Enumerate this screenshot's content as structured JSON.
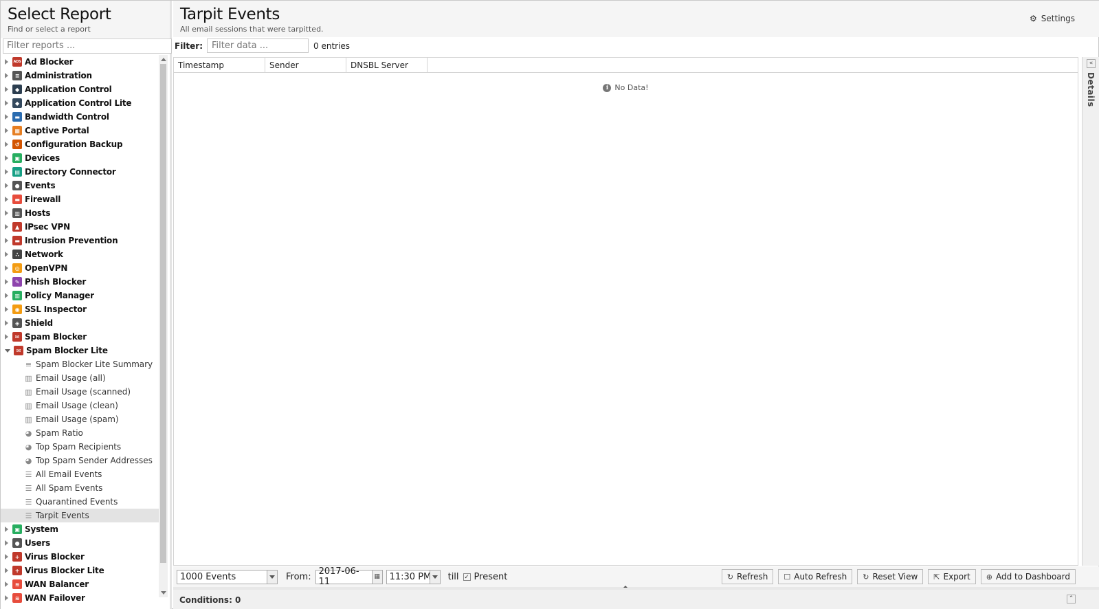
{
  "left": {
    "title": "Select Report",
    "subtitle": "Find or select a report",
    "filter_placeholder": "Filter reports ...",
    "apps_before": [
      {
        "label": "Ad Blocker",
        "icon": "ad-blocker-icon",
        "color": "#c0392b",
        "glyph": "ADS"
      },
      {
        "label": "Administration",
        "icon": "administration-icon",
        "color": "#555555",
        "glyph": "≡"
      },
      {
        "label": "Application Control",
        "icon": "application-control-icon",
        "color": "#2c3e50",
        "glyph": "◆"
      },
      {
        "label": "Application Control Lite",
        "icon": "application-control-lite-icon",
        "color": "#34495e",
        "glyph": "◆"
      },
      {
        "label": "Bandwidth Control",
        "icon": "bandwidth-control-icon",
        "color": "#2b6cb0",
        "glyph": "▬"
      },
      {
        "label": "Captive Portal",
        "icon": "captive-portal-icon",
        "color": "#e67e22",
        "glyph": "▦"
      },
      {
        "label": "Configuration Backup",
        "icon": "configuration-backup-icon",
        "color": "#d35400",
        "glyph": "↺"
      },
      {
        "label": "Devices",
        "icon": "devices-icon",
        "color": "#27ae60",
        "glyph": "▣"
      },
      {
        "label": "Directory Connector",
        "icon": "directory-connector-icon",
        "color": "#16a085",
        "glyph": "▤"
      },
      {
        "label": "Events",
        "icon": "events-icon",
        "color": "#555555",
        "glyph": "●"
      },
      {
        "label": "Firewall",
        "icon": "firewall-icon",
        "color": "#e74c3c",
        "glyph": "▬"
      },
      {
        "label": "Hosts",
        "icon": "hosts-icon",
        "color": "#555555",
        "glyph": "▥"
      },
      {
        "label": "IPsec VPN",
        "icon": "ipsec-vpn-icon",
        "color": "#c0392b",
        "glyph": "▲"
      },
      {
        "label": "Intrusion Prevention",
        "icon": "intrusion-prevention-icon",
        "color": "#c0392b",
        "glyph": "▬"
      },
      {
        "label": "Network",
        "icon": "network-icon",
        "color": "#444444",
        "glyph": "∴"
      },
      {
        "label": "OpenVPN",
        "icon": "openvpn-icon",
        "color": "#f39c12",
        "glyph": "◎"
      },
      {
        "label": "Phish Blocker",
        "icon": "phish-blocker-icon",
        "color": "#8e44ad",
        "glyph": "✎"
      },
      {
        "label": "Policy Manager",
        "icon": "policy-manager-icon",
        "color": "#27ae60",
        "glyph": "▥"
      },
      {
        "label": "SSL Inspector",
        "icon": "ssl-inspector-icon",
        "color": "#f39c12",
        "glyph": "◉"
      },
      {
        "label": "Shield",
        "icon": "shield-icon",
        "color": "#555555",
        "glyph": "◈"
      },
      {
        "label": "Spam Blocker",
        "icon": "spam-blocker-icon",
        "color": "#c0392b",
        "glyph": "✉"
      }
    ],
    "expanded_app": {
      "label": "Spam Blocker Lite",
      "icon": "spam-blocker-lite-icon",
      "color": "#c0392b",
      "glyph": "✉"
    },
    "children": [
      {
        "label": "Spam Blocker Lite Summary",
        "icon": "text-report-icon",
        "glyph": "≡"
      },
      {
        "label": "Email Usage (all)",
        "icon": "bar-chart-icon",
        "glyph": "▥"
      },
      {
        "label": "Email Usage (scanned)",
        "icon": "bar-chart-icon",
        "glyph": "▥"
      },
      {
        "label": "Email Usage (clean)",
        "icon": "bar-chart-icon",
        "glyph": "▥"
      },
      {
        "label": "Email Usage (spam)",
        "icon": "bar-chart-icon",
        "glyph": "▥"
      },
      {
        "label": "Spam Ratio",
        "icon": "pie-chart-icon",
        "glyph": "◕"
      },
      {
        "label": "Top Spam Recipients",
        "icon": "pie-chart-icon",
        "glyph": "◕"
      },
      {
        "label": "Top Spam Sender Addresses",
        "icon": "pie-chart-icon",
        "glyph": "◕"
      },
      {
        "label": "All Email Events",
        "icon": "event-list-icon",
        "glyph": "☰"
      },
      {
        "label": "All Spam Events",
        "icon": "event-list-icon",
        "glyph": "☰"
      },
      {
        "label": "Quarantined Events",
        "icon": "event-list-icon",
        "glyph": "☰"
      },
      {
        "label": "Tarpit Events",
        "icon": "event-list-icon",
        "glyph": "☰"
      }
    ],
    "apps_after": [
      {
        "label": "System",
        "icon": "system-icon",
        "color": "#27ae60",
        "glyph": "▣"
      },
      {
        "label": "Users",
        "icon": "users-icon",
        "color": "#555555",
        "glyph": "●"
      },
      {
        "label": "Virus Blocker",
        "icon": "virus-blocker-icon",
        "color": "#c0392b",
        "glyph": "+"
      },
      {
        "label": "Virus Blocker Lite",
        "icon": "virus-blocker-lite-icon",
        "color": "#c0392b",
        "glyph": "+"
      },
      {
        "label": "WAN Balancer",
        "icon": "wan-balancer-icon",
        "color": "#e74c3c",
        "glyph": "≋"
      },
      {
        "label": "WAN Failover",
        "icon": "wan-failover-icon",
        "color": "#e74c3c",
        "glyph": "≋"
      }
    ]
  },
  "main": {
    "title": "Tarpit Events",
    "subtitle": "All email sessions that were tarpitted.",
    "settings_label": "Settings",
    "filter_label": "Filter:",
    "filter_placeholder": "Filter data ...",
    "entries_text": "0 entries",
    "columns": [
      "Timestamp",
      "Sender",
      "DNSBL Server"
    ],
    "no_data": "No Data!",
    "details_label": "Details"
  },
  "toolbar": {
    "limit_value": "1000 Events",
    "from_label": "From:",
    "from_date": "2017-06-11",
    "from_time": "11:30 PM",
    "till_label": "till",
    "present_label": "Present",
    "present_checked": true,
    "buttons": {
      "refresh": "Refresh",
      "auto_refresh": "Auto Refresh",
      "reset_view": "Reset View",
      "export": "Export",
      "add_dashboard": "Add to Dashboard"
    }
  },
  "conditions": {
    "label": "Conditions: 0"
  }
}
